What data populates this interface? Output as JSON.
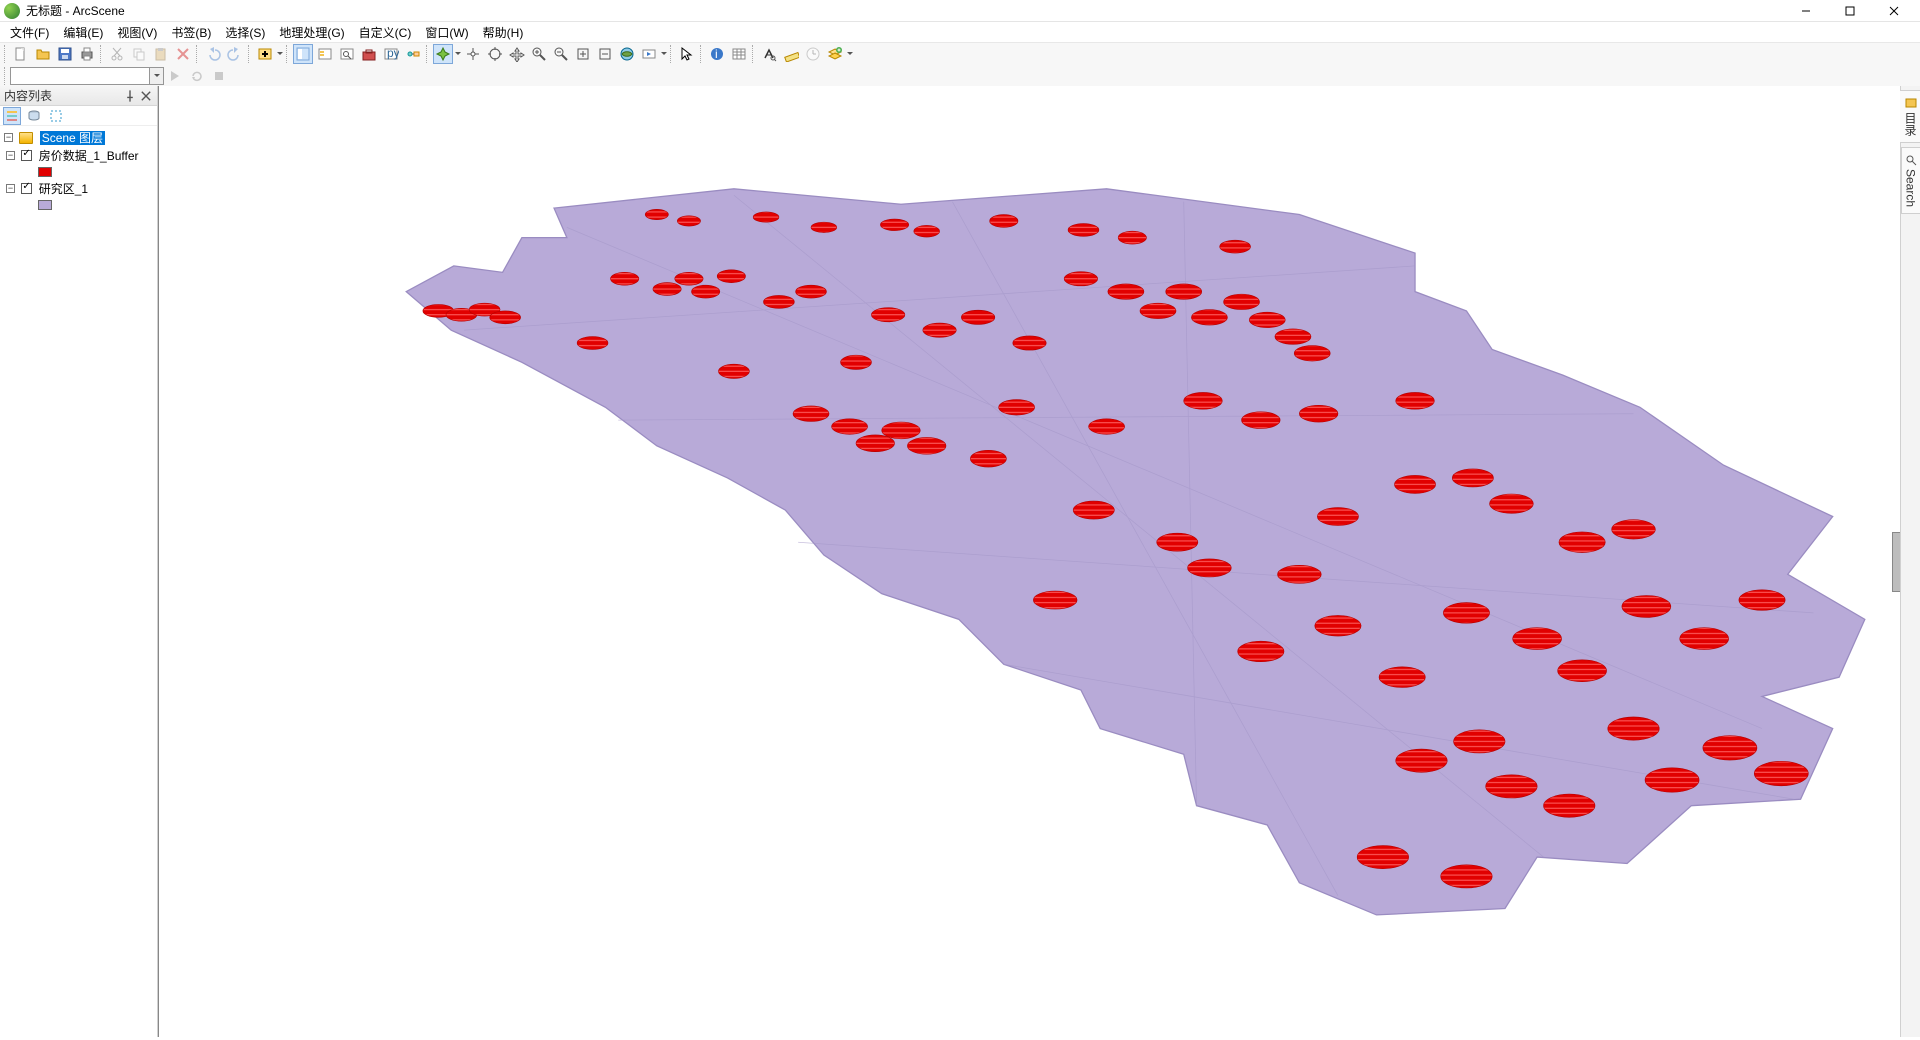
{
  "window": {
    "title": "无标题 - ArcScene",
    "minimize": "最小化",
    "maximize": "最大化",
    "close": "关闭"
  },
  "menu": {
    "file": "文件(F)",
    "edit": "编辑(E)",
    "view": "视图(V)",
    "bookmarks": "书签(B)",
    "selection": "选择(S)",
    "geoprocessing": "地理处理(G)",
    "customize": "自定义(C)",
    "windows": "窗口(W)",
    "help": "帮助(H)"
  },
  "toolbar_icons": {
    "new": "new-file-icon",
    "open": "open-folder-icon",
    "save": "save-icon",
    "print": "print-icon",
    "cut": "cut-icon",
    "copy": "copy-icon",
    "paste": "paste-icon",
    "delete": "delete-icon",
    "undo": "undo-icon",
    "redo": "redo-icon",
    "add_data": "add-data-icon",
    "toc": "toc-icon",
    "catalog": "catalog-window-icon",
    "search": "search-window-icon",
    "toolbox": "toolbox-icon",
    "python": "python-window-icon",
    "modelbuilder": "modelbuilder-icon",
    "navigate": "navigate-icon",
    "fly": "fly-icon",
    "pan": "pan-icon",
    "target": "center-target-icon",
    "zoom_in": "zoom-in-icon",
    "zoom_out": "zoom-out-icon",
    "fixed_zoom_in": "fixed-zoom-in-icon",
    "fixed_zoom_out": "fixed-zoom-out-icon",
    "full_extent": "full-extent-icon",
    "animation": "animation-icon",
    "select": "select-arrow-icon",
    "identify": "identify-icon",
    "attr_table": "attribute-table-icon",
    "find": "find-icon",
    "measure": "measure-icon",
    "time_slider": "time-slider-icon",
    "add_layer": "add-layer-icon",
    "add_network": "add-network-icon",
    "go": "go-icon",
    "refresh": "refresh-icon",
    "stop": "stop-icon"
  },
  "address_bar": {
    "value": ""
  },
  "toc": {
    "title": "内容列表",
    "tb": {
      "list_by_drawing_order": "list-by-drawing-order-icon",
      "list_by_source": "list-by-source-icon",
      "list_by_visibility": "list-by-visibility-icon",
      "list_by_selection": "list-by-selection-icon"
    },
    "root": "Scene 图层",
    "layers": [
      {
        "name": "房价数据_1_Buffer",
        "checked": true,
        "symbol": "red"
      },
      {
        "name": "研究区_1",
        "checked": true,
        "symbol": "lav"
      }
    ]
  },
  "right_dock": {
    "catalog": "目录",
    "search": "Search"
  },
  "colors": {
    "polygon_fill": "#b8aad8",
    "polygon_stroke": "#9486bb",
    "point_fill": "#e10000",
    "selection": "#0078d7"
  }
}
